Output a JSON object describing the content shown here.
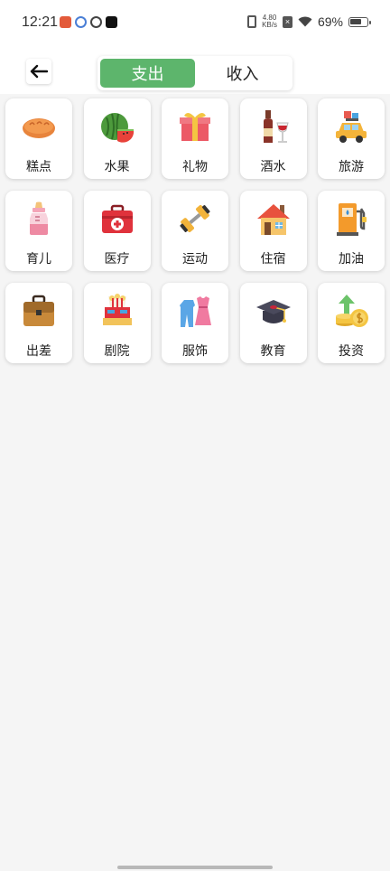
{
  "status_bar": {
    "time": "12:21",
    "net_speed_value": "4.80",
    "net_speed_unit": "KB/s",
    "battery_percent": "69%",
    "battery_level": 0.69
  },
  "header": {
    "back_icon": "arrow-left-icon",
    "tabs": [
      {
        "label": "支出",
        "active": true
      },
      {
        "label": "收入",
        "active": false
      }
    ]
  },
  "colors": {
    "accent": "#5db56c",
    "background": "#f5f5f5",
    "card": "#ffffff"
  },
  "categories": [
    {
      "label": "糕点",
      "icon": "bread-icon"
    },
    {
      "label": "水果",
      "icon": "watermelon-icon"
    },
    {
      "label": "礼物",
      "icon": "gift-icon"
    },
    {
      "label": "酒水",
      "icon": "wine-icon"
    },
    {
      "label": "旅游",
      "icon": "travel-car-icon"
    },
    {
      "label": "育儿",
      "icon": "baby-bottle-icon"
    },
    {
      "label": "医疗",
      "icon": "first-aid-kit-icon"
    },
    {
      "label": "运动",
      "icon": "dumbbell-icon"
    },
    {
      "label": "住宿",
      "icon": "house-icon"
    },
    {
      "label": "加油",
      "icon": "fuel-pump-icon"
    },
    {
      "label": "出差",
      "icon": "briefcase-icon"
    },
    {
      "label": "剧院",
      "icon": "theater-icon"
    },
    {
      "label": "服饰",
      "icon": "clothes-icon"
    },
    {
      "label": "教育",
      "icon": "graduation-cap-icon"
    },
    {
      "label": "投资",
      "icon": "investment-coins-icon"
    }
  ]
}
